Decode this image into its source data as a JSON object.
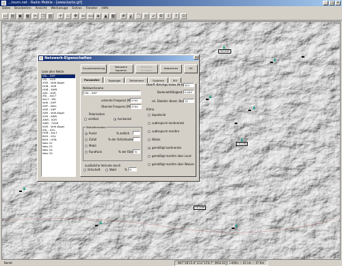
{
  "app": {
    "title": "...tourn.net - Radio Mobile - [www.karte.gif]",
    "window_buttons": [
      "_",
      "□",
      "×"
    ]
  },
  "menu": [
    "Datei",
    "Bearbeiten",
    "Ansicht",
    "Werkzeuge",
    "Extras",
    "Fenster",
    "Hilfe"
  ],
  "toolbar": {
    "buttons": [
      "new-icon",
      "open-icon",
      "save-icon",
      "print-icon",
      "cut-icon",
      "copy-icon",
      "paste-icon",
      "zoom-in-icon",
      "zoom-out-icon",
      "pan-icon",
      "measure-icon",
      "link-icon",
      "network-icon",
      "antenna-icon",
      "map-icon",
      "grid-icon",
      "elevation-icon",
      "profile-icon",
      "coverage-icon",
      "route-icon",
      "settings-icon",
      "info-icon",
      "help-icon",
      "exit-icon"
    ]
  },
  "status": {
    "left": "Bereit",
    "coords": "N47°28'15.6\" E13°15'8.7\" (N50.61°)",
    "elev": "1400m  ~ 42 km  ~ 47 Km"
  },
  "map_labels": [
    "OE2XGR",
    "",
    "",
    "",
    "",
    "",
    "OE2XNJ",
    "",
    "OE2XRR",
    "",
    ""
  ],
  "dialog": {
    "title": "Netzwerk-Eigenschaften",
    "list_title": "Liste aller Netze",
    "networks": [
      "VSL - XHP",
      "VSL - XGR",
      "XGR - Veitl-Kogel",
      "HOB - XGR",
      "HOB - XWR",
      "XZK - XGR",
      "XSL - Ast-T",
      "Ast-T - XSL",
      "Veitl - XHP",
      "XHP - VeitL",
      "XGR - XHP",
      "XDR - Veitl-Kogel",
      "XGR - XWR",
      "XWR - XGR",
      "XWR - 7XGR",
      "XGR - Veitl-Kogel",
      "XSL - XGL",
      "HOB - Ast-T",
      "BGH - XGL",
      "BGH - HOB",
      "Netz 22",
      "Netz 23",
      "Netz 24",
      "Netz 25"
    ],
    "selected_index": 0,
    "buttons": {
      "defaults": "Grundeinstellung",
      "copy_network": "Netzwerk kopieren",
      "paste_network": "Netzwerk einfügen",
      "cancel": "Abbrechen",
      "ok": "OK"
    },
    "tabs": [
      "Parameter",
      "Topologie",
      "Teilnehmer",
      "Systeme",
      "Stil"
    ],
    "active_tab": 0,
    "params": {
      "name_label": "Netzwerkname",
      "name_value": "VSL - XHP",
      "min_freq_label": "unterste Frequenz [MHz]",
      "min_freq_value": "5700",
      "max_freq_label": "Oberste Frequenz [MHz]",
      "max_freq_value": "5700",
      "polarization_label": "Polarisation",
      "pol_vertical": "vertikal",
      "pol_horizontal": "horizontal",
      "polarization_selected": "horizontal",
      "statistics_label": "Statistikmodus",
      "stat_point": "Punkt",
      "stat_random": "Zufall",
      "stat_mobile": "Mobil",
      "stat_broadcast": "Rundfunk",
      "stat_selected": "Punkt",
      "time_label": "% zeitlich",
      "locations_label": "% der Ortlichkeiten",
      "situations_label": "% der Fälle",
      "situations_value": "70",
      "extra_loss_label": "zusätzliche Verluste durch",
      "loss_city": "Ortschaft",
      "loss_forest": "Wald",
      "loss_pct": "%",
      "loss_value": "0",
      "refractivity_label": "Oberfl.-Brechgs-Index (N-Einh.)",
      "refractivity_value": "301",
      "conductivity_label": "Bodenleitfähigkeit (S/m)",
      "conductivity_value": "0,005",
      "permittivity_label": "rel. Dielektr.-Konst. Boden",
      "permittivity_value": "15",
      "climate_label": "Klima",
      "climates": [
        "äquatorial",
        "subtropisch kontinental",
        "subtropisch maritim",
        "Wüste",
        "gemäßigt kontinental",
        "gemäßigt maritim über Land",
        "gemäßigt maritim über Wasser"
      ],
      "climate_selected": "gemäßigt kontinental"
    }
  }
}
